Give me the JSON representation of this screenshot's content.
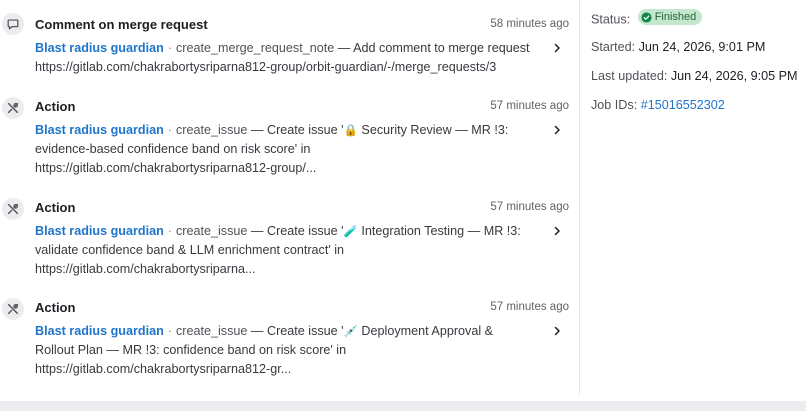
{
  "activity": {
    "items": [
      {
        "icon": "comment-icon",
        "title": "Comment on merge request",
        "time": "58 minutes ago",
        "agent": "Blast radius guardian",
        "tool": "create_merge_request_note",
        "description": "— Add comment to merge request",
        "line2": "https://gitlab.com/chakrabortysriparna812-group/orbit-guardian/-/merge_requests/3",
        "line3": ""
      },
      {
        "icon": "tools-icon",
        "title": "Action",
        "time": "57 minutes ago",
        "agent": "Blast radius guardian",
        "tool": "create_issue",
        "description": "— Create issue '",
        "emoji": "🔒",
        "description_after": " Security Review — MR !3:",
        "line2": "evidence-based confidence band on risk score' in",
        "line3": "https://gitlab.com/chakrabortysriparna812-group/..."
      },
      {
        "icon": "tools-icon",
        "title": "Action",
        "time": "57 minutes ago",
        "agent": "Blast radius guardian",
        "tool": "create_issue",
        "description": "— Create issue '",
        "emoji": "🧪",
        "description_after": " Integration Testing — MR !3:",
        "line2": "validate confidence band & LLM enrichment contract' in",
        "line3": "https://gitlab.com/chakrabortysriparna..."
      },
      {
        "icon": "tools-icon",
        "title": "Action",
        "time": "57 minutes ago",
        "agent": "Blast radius guardian",
        "tool": "create_issue",
        "description": "— Create issue '",
        "emoji": "💉",
        "description_after": " Deployment Approval &",
        "line2": "Rollout Plan — MR !3: confidence band on risk score' in",
        "line3": "https://gitlab.com/chakrabortysriparna812-gr..."
      }
    ]
  },
  "details": {
    "status_label": "Status:",
    "status_value": "Finished",
    "started_label": "Started:",
    "started_value": "Jun 24, 2026, 9:01 PM",
    "updated_label": "Last updated:",
    "updated_value": "Jun 24, 2026, 9:05 PM",
    "jobs_label": "Job IDs:",
    "job_id": "#15016552302"
  },
  "colors": {
    "link": "#1f75cb",
    "success_bg": "#c3e6cd",
    "success_fg": "#24663b",
    "success_icon": "#108548"
  }
}
